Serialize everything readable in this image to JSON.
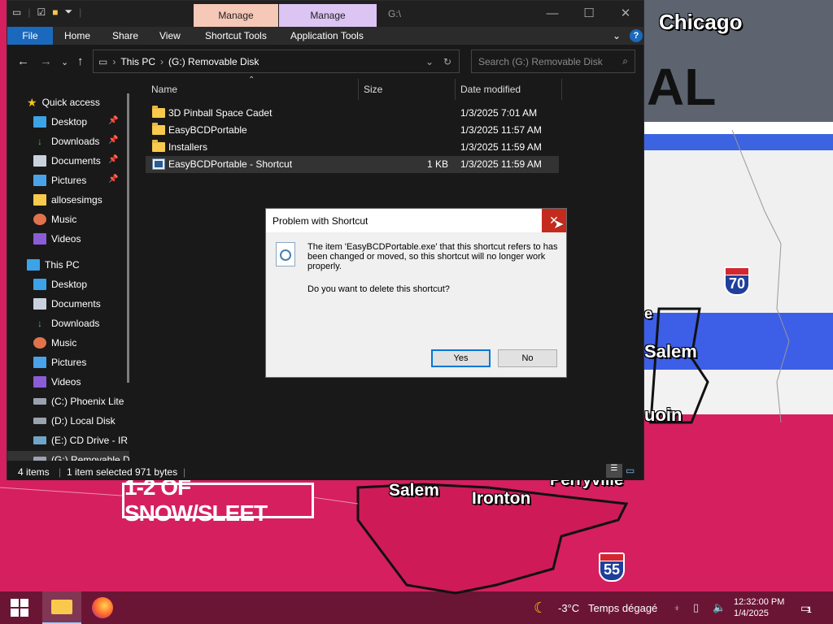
{
  "map": {
    "cities": [
      "Chicago",
      "Salem",
      "Salem",
      "Ironton",
      "Perryville",
      "uoin",
      "e"
    ],
    "big_text": "AL",
    "pill": "1-2 OF SNOW/SLEET",
    "shields": [
      "70",
      "55"
    ]
  },
  "explorer": {
    "context_tabs": [
      "Manage",
      "Manage"
    ],
    "window_title": "G:\\",
    "ribbon_tabs": [
      "File",
      "Home",
      "Share",
      "View",
      "Shortcut Tools",
      "Application Tools"
    ],
    "breadcrumb": [
      "This PC",
      "(G:) Removable Disk"
    ],
    "search_placeholder": "Search (G:) Removable Disk",
    "nav": {
      "quick_access": "Quick access",
      "quick_items": [
        "Desktop",
        "Downloads",
        "Documents",
        "Pictures",
        "allosesimgs",
        "Music",
        "Videos"
      ],
      "this_pc": "This PC",
      "pc_items": [
        "Desktop",
        "Documents",
        "Downloads",
        "Music",
        "Pictures",
        "Videos",
        "(C:) Phoenix Lite",
        "(D:) Local Disk",
        "(E:) CD Drive - IR",
        "(G:) Removable Di"
      ]
    },
    "columns": {
      "name": "Name",
      "size": "Size",
      "date": "Date modified"
    },
    "files": [
      {
        "name": "3D Pinball Space Cadet",
        "size": "",
        "date": "1/3/2025 7:01 AM",
        "type": "folder"
      },
      {
        "name": "EasyBCDPortable",
        "size": "",
        "date": "1/3/2025 11:57 AM",
        "type": "folder"
      },
      {
        "name": "Installers",
        "size": "",
        "date": "1/3/2025 11:59 AM",
        "type": "folder"
      },
      {
        "name": "EasyBCDPortable - Shortcut",
        "size": "1 KB",
        "date": "1/3/2025 11:59 AM",
        "type": "shortcut"
      }
    ],
    "status": {
      "count": "4 items",
      "selected": "1 item selected  971 bytes"
    }
  },
  "dialog": {
    "title": "Problem with Shortcut",
    "message": "The item 'EasyBCDPortable.exe' that this shortcut refers to has been changed or moved, so this shortcut will no longer work properly.",
    "question": "Do you want to delete this shortcut?",
    "yes": "Yes",
    "no": "No"
  },
  "taskbar": {
    "temp": "-3°C",
    "weather": "Temps dégagé",
    "time": "12:32:00 PM",
    "date": "1/4/2025",
    "notifications": "1"
  }
}
